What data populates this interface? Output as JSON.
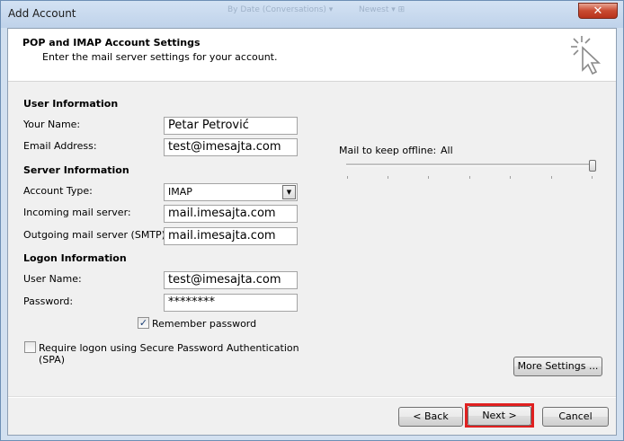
{
  "window": {
    "title": "Add Account",
    "ghost_title_left": "By Date (Conversations) ▾",
    "ghost_title_right": "Newest ▾ ⊞",
    "close_glyph": "✕"
  },
  "header": {
    "title": "POP and IMAP Account Settings",
    "subtitle": "Enter the mail server settings for your account.",
    "icon": "wizard-cursor-icon"
  },
  "user_info": {
    "heading": "User Information",
    "your_name_label": "Your Name:",
    "your_name_value": "Petar Petrović",
    "email_label": "Email Address:",
    "email_value": "test@imesajta.com"
  },
  "server_info": {
    "heading": "Server Information",
    "account_type_label": "Account Type:",
    "account_type_value": "IMAP",
    "incoming_label": "Incoming mail server:",
    "incoming_value": "mail.imesajta.com",
    "outgoing_label": "Outgoing mail server (SMTP):",
    "outgoing_value": "mail.imesajta.com"
  },
  "logon_info": {
    "heading": "Logon Information",
    "username_label": "User Name:",
    "username_value": "test@imesajta.com",
    "password_label": "Password:",
    "password_value": "********",
    "remember_label": "Remember password",
    "remember_checked": true,
    "spa_label_line1": "Require logon using Secure Password Authentication",
    "spa_label_line2": "(SPA)",
    "spa_checked": false
  },
  "offline": {
    "label": "Mail to keep offline:",
    "value": "All",
    "slider_level": 1.0
  },
  "buttons": {
    "more_settings": "More Settings ...",
    "back": "< Back",
    "next": "Next >",
    "cancel": "Cancel"
  },
  "colors": {
    "highlight": "#e02020",
    "checkmark": "#1b3f75"
  }
}
